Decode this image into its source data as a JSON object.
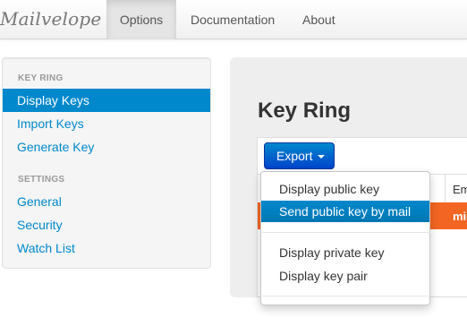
{
  "navbar": {
    "brand": "Mailvelope",
    "items": [
      {
        "label": "Options",
        "active": true
      },
      {
        "label": "Documentation",
        "active": false
      },
      {
        "label": "About",
        "active": false
      }
    ]
  },
  "sidebar": {
    "sections": [
      {
        "header": "KEY RING",
        "items": [
          "Display Keys",
          "Import Keys",
          "Generate Key"
        ]
      },
      {
        "header": "SETTINGS",
        "items": [
          "General",
          "Security",
          "Watch List"
        ]
      }
    ],
    "active_item": "Display Keys"
  },
  "main": {
    "title": "Key Ring",
    "export_button": "Export",
    "table": {
      "visible_header": "Em",
      "selected_row_text": "mic"
    },
    "export_menu": {
      "items": [
        "Display public key",
        "Send public key by mail",
        "Display private key",
        "Display key pair"
      ],
      "active_item": "Send public key by mail"
    }
  },
  "colors": {
    "link": "#0088cc",
    "active_bg": "#0088cc",
    "selected_row": "#f26522",
    "export_button": "#0044cc"
  }
}
